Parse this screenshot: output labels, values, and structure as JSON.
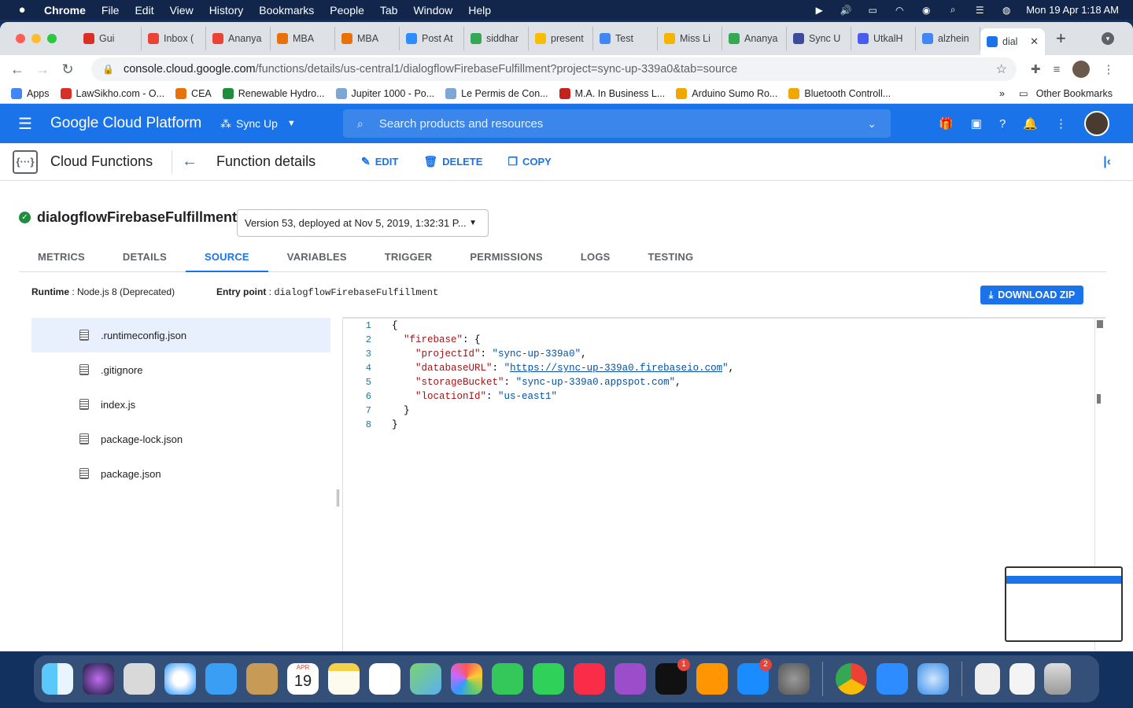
{
  "menubar": {
    "apple": "",
    "items": [
      "Chrome",
      "File",
      "Edit",
      "View",
      "History",
      "Bookmarks",
      "People",
      "Tab",
      "Window",
      "Help"
    ],
    "datetime": "Mon 19 Apr  1:18 AM"
  },
  "browser": {
    "tabs": [
      {
        "label": "Gui",
        "color": "#d93025"
      },
      {
        "label": "Inbox (",
        "color": "#ea4335"
      },
      {
        "label": "Ananya",
        "color": "#ea4335"
      },
      {
        "label": "MBA",
        "color": "#e8710a"
      },
      {
        "label": "MBA",
        "color": "#e8710a"
      },
      {
        "label": "Post At",
        "color": "#2d8cff"
      },
      {
        "label": "siddhar",
        "color": "#34a853"
      },
      {
        "label": "present",
        "color": "#fbbc04"
      },
      {
        "label": "Test",
        "color": "#4285f4"
      },
      {
        "label": "Miss Li",
        "color": "#f4b400"
      },
      {
        "label": "Ananya",
        "color": "#34a853"
      },
      {
        "label": "Sync U",
        "color": "#3c4b9b"
      },
      {
        "label": "UtkalH",
        "color": "#4a5cf0"
      },
      {
        "label": "alzhein",
        "color": "#4285f4"
      },
      {
        "label": "dial",
        "color": "#1a73e8"
      }
    ],
    "active_tab_close": "✕",
    "new_tab": "+",
    "url_host": "console.cloud.google.com",
    "url_path": "/functions/details/us-central1/dialogflowFirebaseFulfillment?project=sync-up-339a0&tab=source",
    "bookmarks": [
      {
        "label": "Apps",
        "color": "#4285f4"
      },
      {
        "label": "LawSikho.com - O...",
        "color": "#d93025"
      },
      {
        "label": "CEA",
        "color": "#e8710a"
      },
      {
        "label": "Renewable Hydro...",
        "color": "#1e8e3e"
      },
      {
        "label": "Jupiter 1000 - Po...",
        "color": "#7aa7d6"
      },
      {
        "label": "Le Permis de Con...",
        "color": "#7aa7d6"
      },
      {
        "label": "M.A. In Business L...",
        "color": "#c5221f"
      },
      {
        "label": "Arduino Sumo Ro...",
        "color": "#f2a600"
      },
      {
        "label": "Bluetooth Controll...",
        "color": "#f2a600"
      }
    ],
    "bookmarks_more": "»",
    "other_bookmarks": "Other Bookmarks"
  },
  "gcp": {
    "title": "Google Cloud Platform",
    "project": "Sync Up",
    "search_placeholder": "Search products and resources"
  },
  "subbar": {
    "product": "Cloud Functions",
    "page_title": "Function details",
    "edit": "EDIT",
    "delete": "DELETE",
    "copy": "COPY"
  },
  "function": {
    "name": "dialogflowFirebaseFulfillment",
    "version": "Version 53, deployed at Nov 5, 2019, 1:32:31 P...",
    "tabs": [
      "METRICS",
      "DETAILS",
      "SOURCE",
      "VARIABLES",
      "TRIGGER",
      "PERMISSIONS",
      "LOGS",
      "TESTING"
    ],
    "active_tab": "SOURCE",
    "runtime_label": "Runtime",
    "runtime_value": " : Node.js 8 (Deprecated)",
    "entry_label": "Entry point",
    "entry_sep": " : ",
    "entry_value": "dialogflowFirebaseFulfillment",
    "download": "DOWNLOAD ZIP"
  },
  "files": [
    ".runtimeconfig.json",
    ".gitignore",
    "index.js",
    "package-lock.json",
    "package.json"
  ],
  "selected_file": ".runtimeconfig.json",
  "code_lines": [
    {
      "n": "1"
    },
    {
      "n": "2"
    },
    {
      "n": "3"
    },
    {
      "n": "4"
    },
    {
      "n": "5"
    },
    {
      "n": "6"
    },
    {
      "n": "7"
    },
    {
      "n": "8"
    }
  ],
  "code": {
    "firebase_key": "\"firebase\"",
    "projectId_key": "\"projectId\"",
    "projectId_val": "\"sync-up-339a0\"",
    "databaseURL_key": "\"databaseURL\"",
    "databaseURL_val": "https://sync-up-339a0.firebaseio.com",
    "storageBucket_key": "\"storageBucket\"",
    "storageBucket_val": "\"sync-up-339a0.appspot.com\"",
    "locationId_key": "\"locationId\"",
    "locationId_val": "\"us-east1\""
  },
  "dock": {
    "calendar_month": "APR",
    "calendar_day": "19",
    "tv_badge": "1",
    "appstore_badge": "2"
  }
}
